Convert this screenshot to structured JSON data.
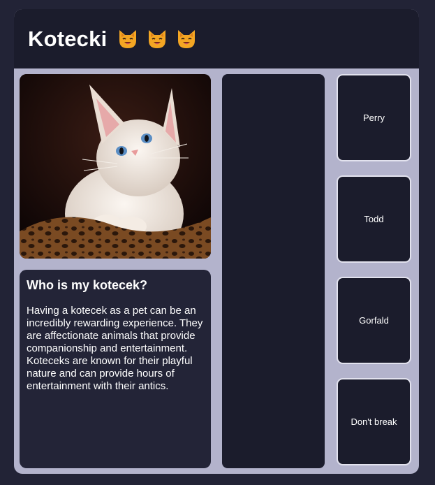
{
  "header": {
    "title": "Kotecki",
    "emoji": [
      "cat-face-icon",
      "cat-face-icon",
      "cat-face-icon"
    ]
  },
  "photo": {
    "subject": "kitten-photo"
  },
  "info": {
    "heading": "Who is my kotecek?",
    "body": "Having a kotecek as a pet can be an incredibly rewarding experience. They are affectionate animals that provide companionship and entertainment. Koteceks are known for their playful nature and can provide hours of entertainment with their antics."
  },
  "cats": [
    {
      "label": "Perry"
    },
    {
      "label": "Todd"
    },
    {
      "label": "Gorfald"
    },
    {
      "label": "Don't break"
    }
  ],
  "colors": {
    "page_background": "#222336",
    "panel_frame": "#b3b3cc",
    "dark_panel": "#1b1c2c",
    "info_panel": "#232437",
    "button_border": "#e2e2ee",
    "text": "#ffffff"
  }
}
